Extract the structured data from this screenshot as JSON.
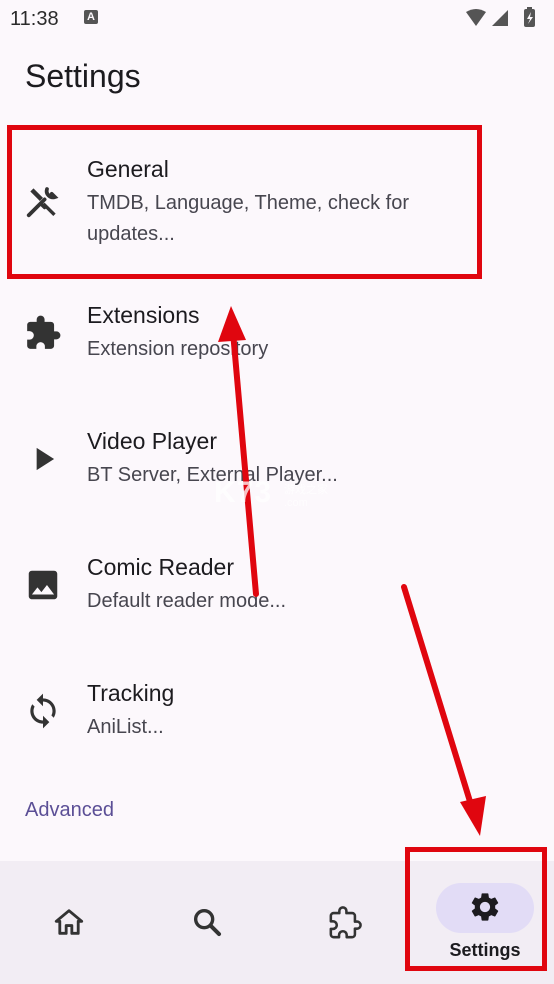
{
  "status_bar": {
    "time": "11:38",
    "notification_badge": "A"
  },
  "page": {
    "title": "Settings"
  },
  "settings_items": [
    {
      "icon": "tools-icon",
      "title": "General",
      "subtitle": "TMDB, Language, Theme, check for updates..."
    },
    {
      "icon": "puzzle-icon",
      "title": "Extensions",
      "subtitle": "Extension repository"
    },
    {
      "icon": "play-icon",
      "title": "Video Player",
      "subtitle": "BT Server, External Player..."
    },
    {
      "icon": "image-icon",
      "title": "Comic Reader",
      "subtitle": "Default reader mode..."
    },
    {
      "icon": "sync-icon",
      "title": "Tracking",
      "subtitle": "AniList..."
    }
  ],
  "section_header": "Advanced",
  "bottom_nav": [
    {
      "icon": "home-icon",
      "label": ""
    },
    {
      "icon": "search-icon",
      "label": ""
    },
    {
      "icon": "puzzle-icon",
      "label": ""
    },
    {
      "icon": "gear-icon",
      "label": "Settings",
      "selected": true
    }
  ],
  "watermark": {
    "brand": "K73",
    "site": "游戏之家",
    "domain": ".com"
  },
  "colors": {
    "accent": "#5b4f96",
    "highlight": "#e0060f",
    "nav_bg": "#f2edf4",
    "pill": "#e2dcf6"
  }
}
